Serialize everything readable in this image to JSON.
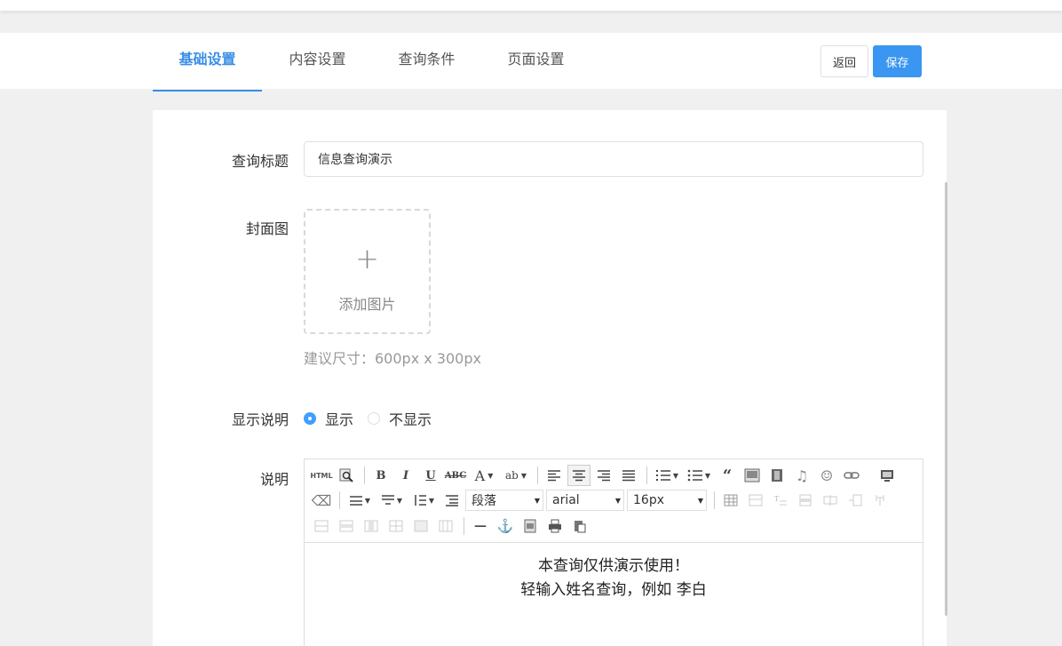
{
  "tabs": [
    {
      "label": "基础设置",
      "active": true
    },
    {
      "label": "内容设置",
      "active": false
    },
    {
      "label": "查询条件",
      "active": false
    },
    {
      "label": "页面设置",
      "active": false
    }
  ],
  "actions": {
    "back_label": "返回",
    "save_label": "保存"
  },
  "form": {
    "title_label": "查询标题",
    "title_value": "信息查询演示",
    "cover_label": "封面图",
    "upload_text": "添加图片",
    "upload_plus": "+",
    "size_hint": "建议尺寸：600px x 300px",
    "show_desc_label": "显示说明",
    "radio_show": "显示",
    "radio_hide": "不显示",
    "desc_label": "说明"
  },
  "editor": {
    "paragraph_select": "段落",
    "font_select": "arial",
    "size_select": "16px",
    "content_lines": [
      "本查询仅供演示使用！",
      "轻输入姓名查询，例如 李白"
    ]
  },
  "colors": {
    "accent": "#3a8ee6",
    "save_button": "#3a96f0"
  }
}
